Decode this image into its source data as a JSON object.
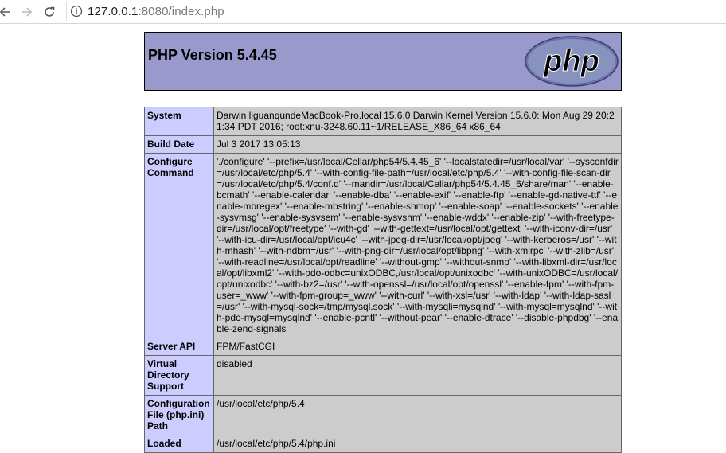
{
  "browser": {
    "url_host": "127.0.0.1",
    "url_rest": ":8080/index.php",
    "icons": [
      "back-arrow-icon",
      "forward-arrow-icon",
      "reload-icon",
      "info-icon"
    ]
  },
  "header": {
    "title": "PHP Version 5.4.45",
    "logo_text": "php",
    "bg_color": "#9999cc"
  },
  "rows": [
    {
      "label": "System",
      "value": "Darwin liguanqundeMacBook-Pro.local 15.6.0 Darwin Kernel Version 15.6.0: Mon Aug 29 20:21:34 PDT 2016; root:xnu-3248.60.11~1/RELEASE_X86_64 x86_64"
    },
    {
      "label": "Build Date",
      "value": "Jul 3 2017 13:05:13"
    },
    {
      "label": "Configure Command",
      "value": "'./configure' '--prefix=/usr/local/Cellar/php54/5.4.45_6' '--localstatedir=/usr/local/var' '--sysconfdir=/usr/local/etc/php/5.4' '--with-config-file-path=/usr/local/etc/php/5.4' '--with-config-file-scan-dir=/usr/local/etc/php/5.4/conf.d' '--mandir=/usr/local/Cellar/php54/5.4.45_6/share/man' '--enable-bcmath' '--enable-calendar' '--enable-dba' '--enable-exif' '--enable-ftp' '--enable-gd-native-ttf' '--enable-mbregex' '--enable-mbstring' '--enable-shmop' '--enable-soap' '--enable-sockets' '--enable-sysvmsg' '--enable-sysvsem' '--enable-sysvshm' '--enable-wddx' '--enable-zip' '--with-freetype-dir=/usr/local/opt/freetype' '--with-gd' '--with-gettext=/usr/local/opt/gettext' '--with-iconv-dir=/usr' '--with-icu-dir=/usr/local/opt/icu4c' '--with-jpeg-dir=/usr/local/opt/jpeg' '--with-kerberos=/usr' '--with-mhash' '--with-ndbm=/usr' '--with-png-dir=/usr/local/opt/libpng' '--with-xmlrpc' '--with-zlib=/usr' '--with-readline=/usr/local/opt/readline' '--without-gmp' '--without-snmp' '--with-libxml-dir=/usr/local/opt/libxml2' '--with-pdo-odbc=unixODBC,/usr/local/opt/unixodbc' '--with-unixODBC=/usr/local/opt/unixodbc' '--with-bz2=/usr' '--with-openssl=/usr/local/opt/openssl' '--enable-fpm' '--with-fpm-user=_www' '--with-fpm-group=_www' '--with-curl' '--with-xsl=/usr' '--with-ldap' '--with-ldap-sasl=/usr' '--with-mysql-sock=/tmp/mysql.sock' '--with-mysqli=mysqlnd' '--with-mysql=mysqlnd' '--with-pdo-mysql=mysqlnd' '--enable-pcntl' '--without-pear' '--enable-dtrace' '--disable-phpdbg' '--enable-zend-signals'"
    },
    {
      "label": "Server API",
      "value": "FPM/FastCGI"
    },
    {
      "label": "Virtual Directory Support",
      "value": "disabled"
    },
    {
      "label": "Configuration File (php.ini) Path",
      "value": "/usr/local/etc/php/5.4"
    },
    {
      "label": "Loaded",
      "value": "/usr/local/etc/php/5.4/php.ini"
    }
  ]
}
